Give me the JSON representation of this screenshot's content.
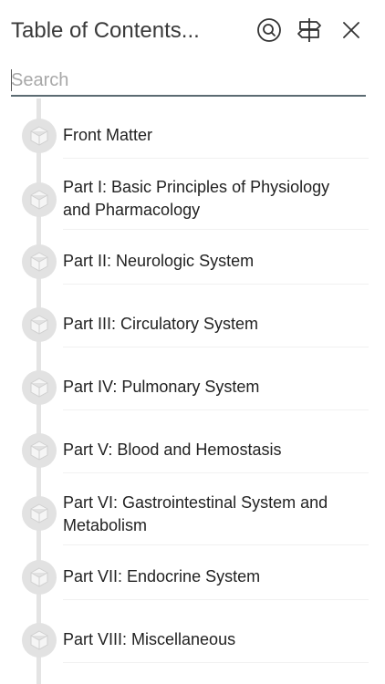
{
  "header": {
    "title": "Table of Contents...",
    "search_button_icon": "search-icon",
    "signpost_button_icon": "signpost-icon",
    "close_button_icon": "close-icon"
  },
  "search": {
    "placeholder": "Search",
    "value": ""
  },
  "toc": {
    "node_icon": "book-cube-icon",
    "items": [
      {
        "label": "Front Matter"
      },
      {
        "label": "Part I: Basic Principles of Physiology and Pharmacology"
      },
      {
        "label": "Part II: Neurologic System"
      },
      {
        "label": "Part III: Circulatory System"
      },
      {
        "label": "Part IV: Pulmonary System"
      },
      {
        "label": "Part V: Blood and Hemostasis"
      },
      {
        "label": "Part VI: Gastrointestinal System and Metabolism"
      },
      {
        "label": "Part VII: Endocrine System"
      },
      {
        "label": "Part VIII: Miscellaneous"
      }
    ]
  },
  "colors": {
    "node": "#e2e2e2",
    "timeline": "#e4e4e4",
    "search_underline": "#5b6b72",
    "text": "#222222"
  }
}
